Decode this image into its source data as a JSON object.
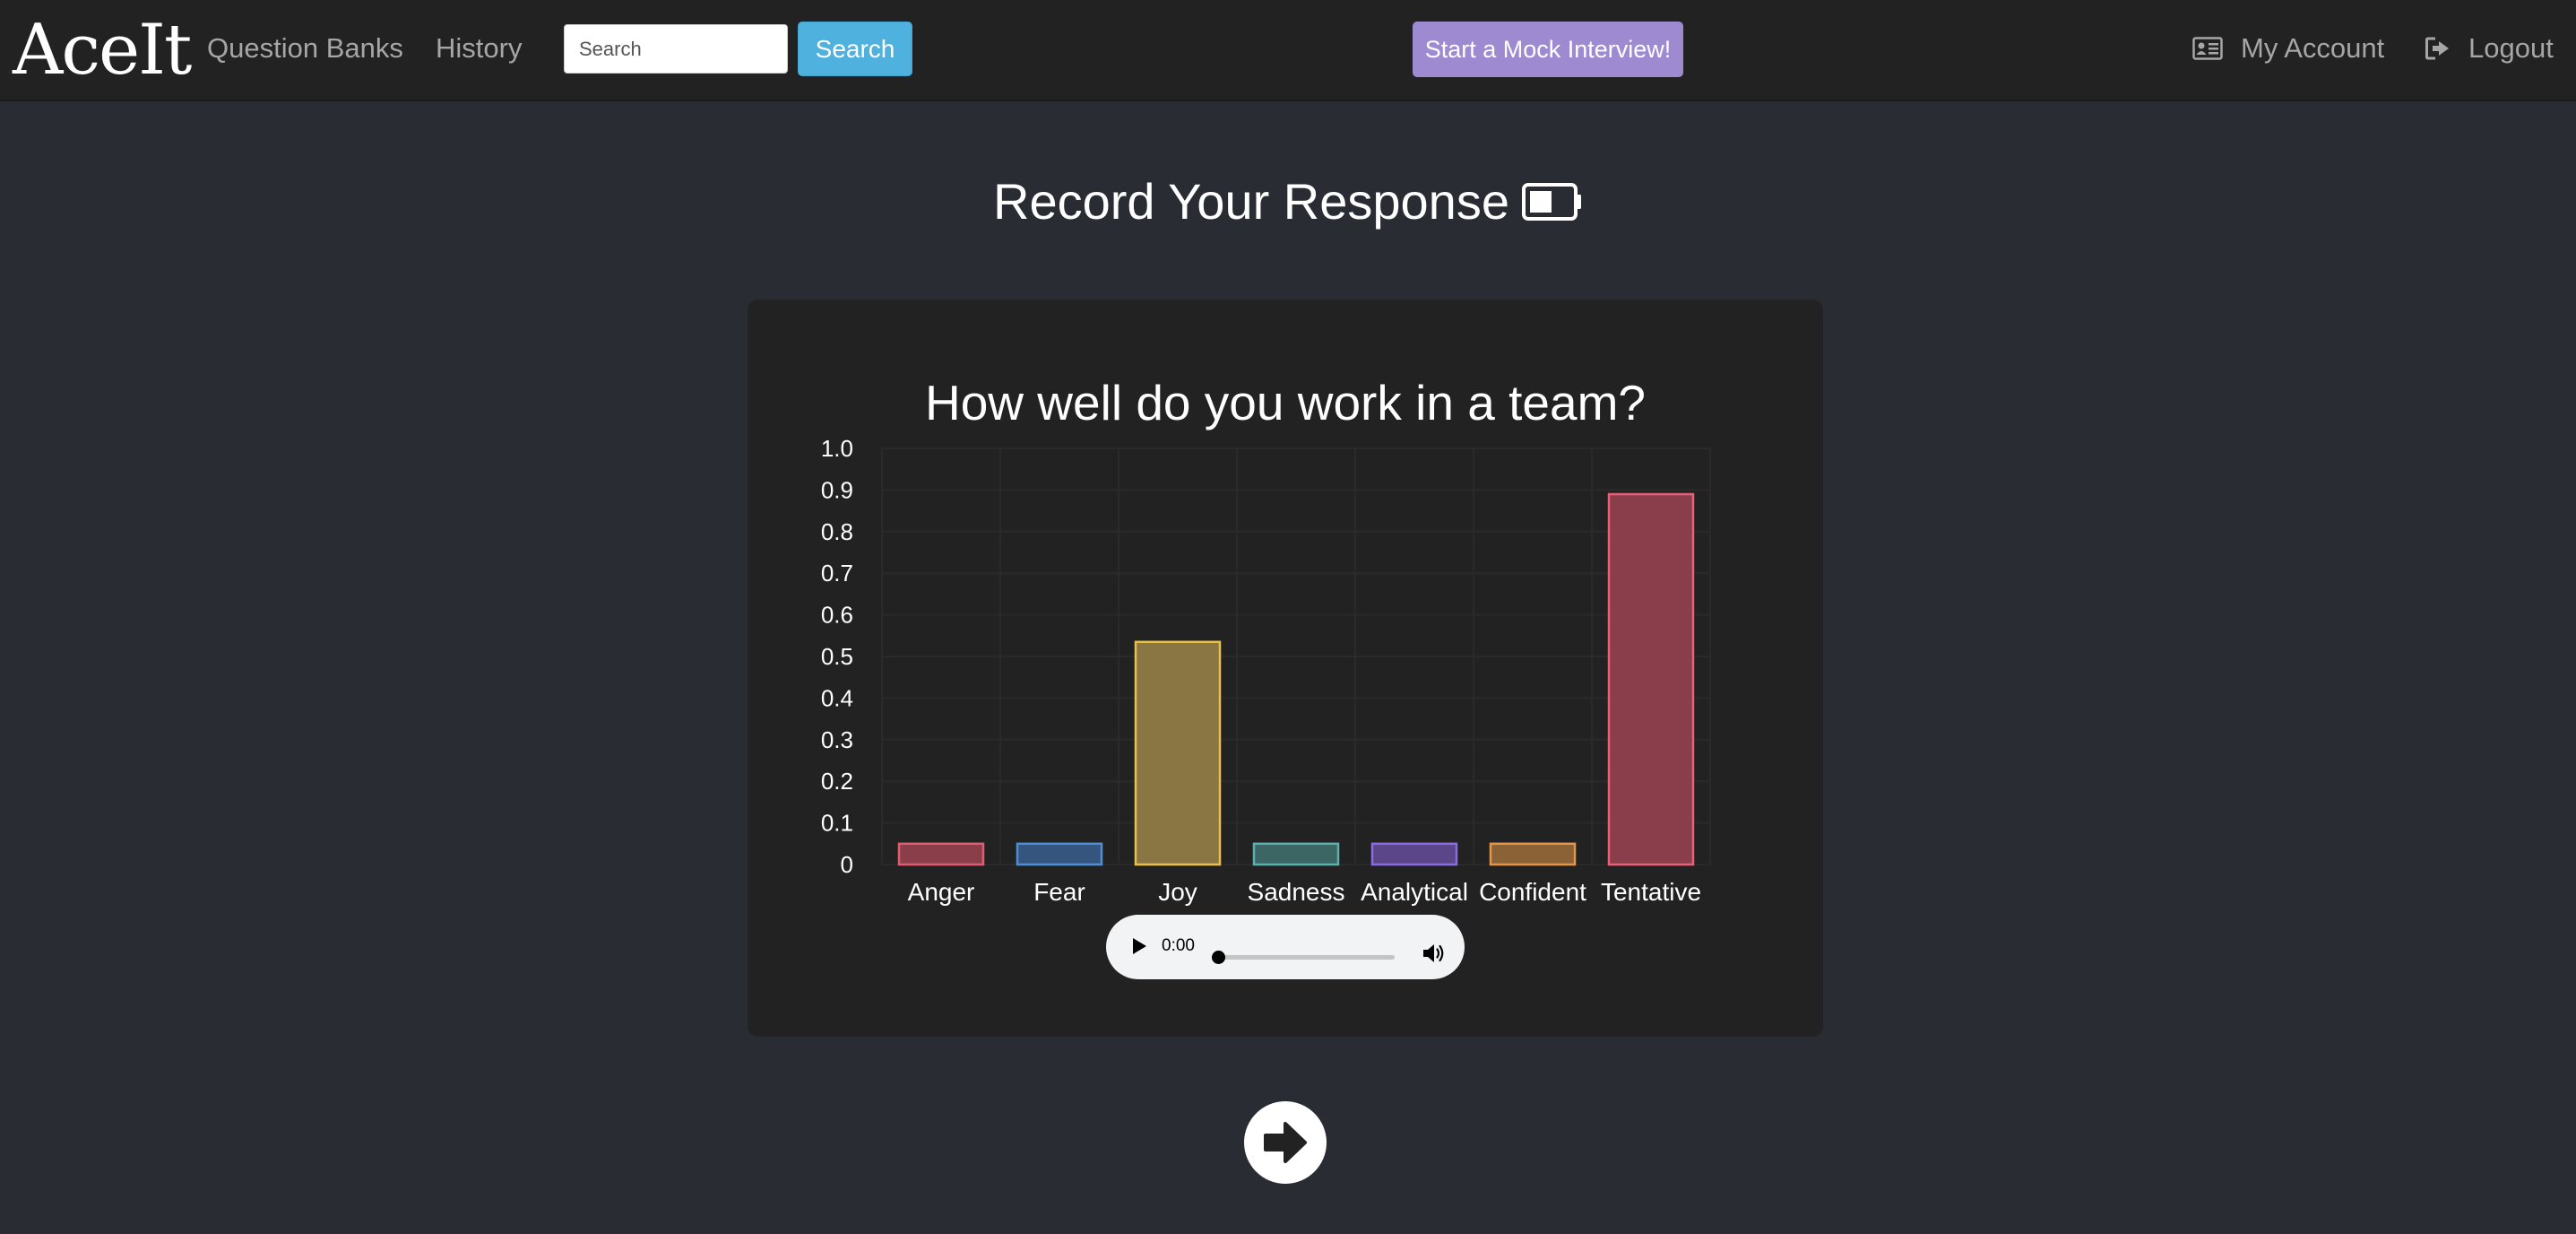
{
  "navbar": {
    "brand": "AceIt",
    "links": {
      "question_banks": "Question Banks",
      "history": "History"
    },
    "search": {
      "placeholder": "Search",
      "value": "",
      "button_label": "Search"
    },
    "mock_interview_label": "Start a Mock Interview!",
    "account_label": "My Account",
    "logout_label": "Logout",
    "icons": {
      "account": "id-card-icon",
      "logout": "sign-out-icon"
    }
  },
  "page": {
    "title": "Record Your Response",
    "title_icon": "battery-icon"
  },
  "card": {
    "question": "How well do you work in a team?"
  },
  "chart_data": {
    "type": "bar",
    "title": "",
    "categories": [
      "Anger",
      "Fear",
      "Joy",
      "Sadness",
      "Analytical",
      "Confident",
      "Tentative"
    ],
    "values": [
      0.05,
      0.05,
      0.535,
      0.05,
      0.05,
      0.05,
      0.89
    ],
    "ylim": [
      0,
      1.0
    ],
    "yticks": [
      "0",
      "0.1",
      "0.2",
      "0.3",
      "0.4",
      "0.5",
      "0.6",
      "0.7",
      "0.8",
      "0.9",
      "1.0"
    ],
    "xlabel": "",
    "ylabel": "",
    "grid": true,
    "legend": "none",
    "colors": {
      "Anger": {
        "fill": "#8a3e4a",
        "stroke": "#e05c70"
      },
      "Fear": {
        "fill": "#36557e",
        "stroke": "#4d8fd4"
      },
      "Joy": {
        "fill": "#8a7642",
        "stroke": "#e8c04e"
      },
      "Sadness": {
        "fill": "#3b6664",
        "stroke": "#5bb0ab"
      },
      "Analytical": {
        "fill": "#5a4688",
        "stroke": "#8b6ce0"
      },
      "Confident": {
        "fill": "#8a6236",
        "stroke": "#e3954a"
      },
      "Tentative": {
        "fill": "#8a3e4c",
        "stroke": "#e56177"
      }
    }
  },
  "audio": {
    "time": "0:00",
    "progress": 0
  },
  "next_button": {
    "icon": "arrow-right-icon"
  }
}
